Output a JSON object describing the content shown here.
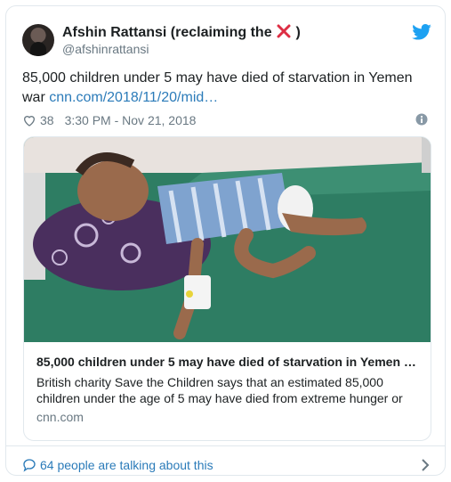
{
  "author": {
    "name": "Afshin Rattansi (reclaiming the",
    "name_suffix": ")",
    "handle": "@afshinrattansi",
    "emoji_icon": "cross-mark-icon"
  },
  "tweet": {
    "text": "85,000 children under 5 may have died of starvation in Yemen war ",
    "link": "cnn.com/2018/11/20/mid…",
    "likes": "38",
    "timestamp": "3:30 PM - Nov 21, 2018"
  },
  "link_card": {
    "title": "85,000 children under 5 may have died of starvation in Yemen …",
    "description": "British charity Save the Children says that an estimated 85,000 children under the age of 5 may have died from extreme hunger or",
    "domain": "cnn.com"
  },
  "footer": {
    "talking": "64 people are talking about this"
  },
  "colors": {
    "link_blue": "#2b7bb9",
    "twitter_blue": "#1da1f2",
    "muted_text": "#697882",
    "border": "#e1e8ed",
    "cross_red": "#dd2e44"
  }
}
